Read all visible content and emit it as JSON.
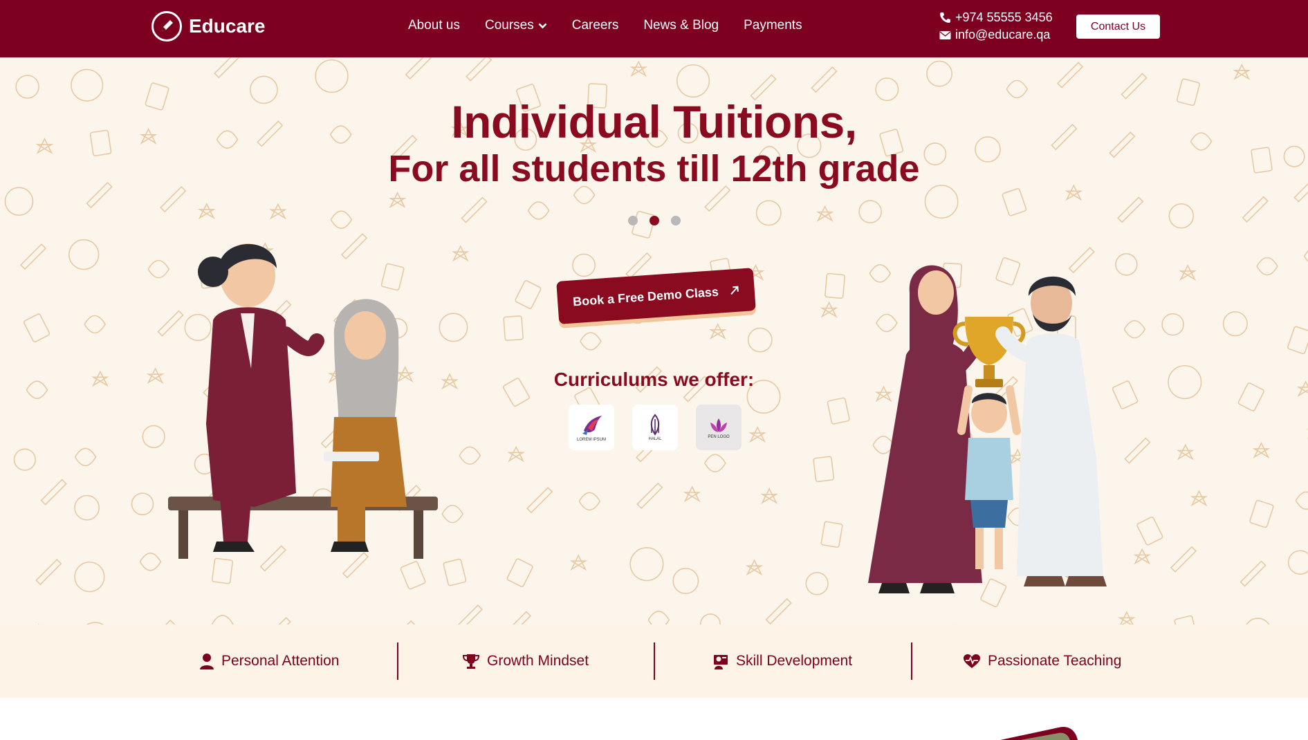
{
  "brand": {
    "name": "Educare"
  },
  "nav": {
    "links": [
      "About us",
      "Courses",
      "Careers",
      "News & Blog",
      "Payments"
    ]
  },
  "contact": {
    "phone": "+974 55555 3456",
    "email": "info@educare.qa",
    "button_label": "Contact Us"
  },
  "hero": {
    "title": "Individual Tuitions,",
    "subtitle": "For all students till 12th grade",
    "slides": {
      "count": 3,
      "active_index": 1
    },
    "cta_label": "Book a Free Demo Class",
    "curriculums_title": "Curriculums we offer:",
    "curriculum_logos": [
      {
        "caption": "LOREM IPSUM"
      },
      {
        "caption": "HALAL"
      },
      {
        "caption": "PEN LOGO"
      }
    ]
  },
  "features": [
    {
      "label": "Personal Attention",
      "icon": "user-icon"
    },
    {
      "label": "Growth Mindset",
      "icon": "trophy-icon"
    },
    {
      "label": "Skill Development",
      "icon": "teacher-icon"
    },
    {
      "label": "Passionate Teaching",
      "icon": "heart-pulse-icon"
    }
  ],
  "colors": {
    "brand": "#7d0020",
    "hero_bg": "#fbf5ec",
    "features_bg": "#fdf3e7",
    "doodle": "#e2b98a",
    "cta_shadow": "#f0c79a"
  }
}
